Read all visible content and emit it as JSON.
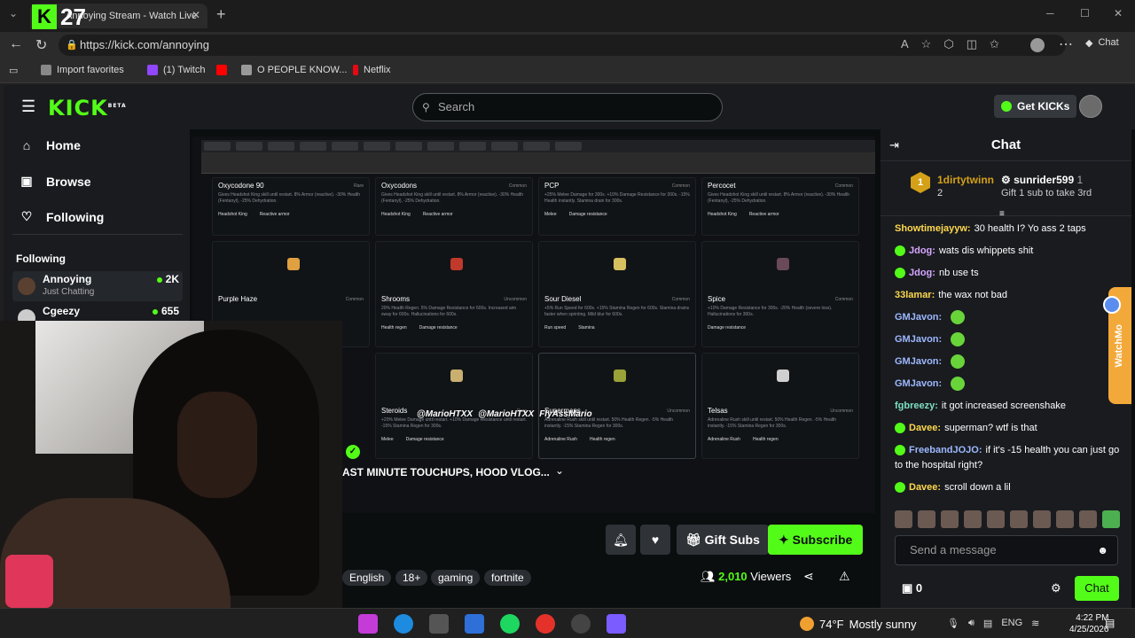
{
  "browser": {
    "tab_title": "Annoying Stream - Watch Live",
    "overlay_k": "K",
    "overlay_number": "27",
    "url": "https://kick.com/annoying",
    "chat_label": "Chat",
    "bookmarks": [
      {
        "label": "Import favorites",
        "color": "#888888"
      },
      {
        "label": "(1) Twitch",
        "color": "#9146ff"
      },
      {
        "label": "",
        "color": "#ff0000"
      },
      {
        "label": "O PEOPLE KNOW...",
        "color": "#999999"
      },
      {
        "label": "Netflix",
        "color": "#e50914"
      }
    ]
  },
  "site": {
    "logo": "KICK",
    "logo_beta": "BETA",
    "search_placeholder": "Search",
    "get_kicks": "Get KICKs",
    "sidebar": {
      "nav": [
        {
          "label": "Home",
          "icon": "home-icon"
        },
        {
          "label": "Browse",
          "icon": "browse-icon"
        },
        {
          "label": "Following",
          "icon": "heart-icon"
        }
      ],
      "following_header": "Following",
      "channels": [
        {
          "name": "Annoying",
          "category": "Just Chatting",
          "viewers": "2K"
        },
        {
          "name": "Cgeezy",
          "category": "",
          "viewers": "655"
        }
      ]
    }
  },
  "stream": {
    "title": "AST MINUTE TOUCHUPS, HOOD VLOG...",
    "tags": [
      "English",
      "18+",
      "gaming",
      "fortnite"
    ],
    "viewers_count": "2,010",
    "viewers_label": "Viewers",
    "gift_subs": "Gift Subs",
    "subscribe": "Subscribe",
    "socials": [
      "@MarioHTXX",
      "@MarioHTXX",
      "FlyAssMario"
    ],
    "cards": [
      {
        "title": "Oxycodone 90",
        "rarity": "Rare",
        "desc": "Gives Headshot King skill until restart. 8% Armor (reactive). -30% Health (Fentanyl), -25% Dehydration.",
        "tags": [
          "Headshot King",
          "Reactive armor"
        ]
      },
      {
        "title": "Oxycodons",
        "rarity": "Common",
        "desc": "Gives Headshot King skill until restart. 8% Armor (reactive). -30% Health (Fentanyl), -25% Dehydration.",
        "tags": [
          "Headshot King",
          "Reactive armor"
        ]
      },
      {
        "title": "PCP",
        "rarity": "Common",
        "desc": "+25% Melee Damage for 300s. +10% Damage Resistance for 300s. -15% Health instantly. Stamina drain for 300s.",
        "tags": [
          "Melee",
          "Damage resistance"
        ]
      },
      {
        "title": "Percocet",
        "rarity": "Common",
        "desc": "Gives Headshot King skill until restart. 8% Armor (reactive). -30% Health (Fentanyl), -25% Dehydration.",
        "tags": [
          "Headshot King",
          "Reactive armor"
        ]
      },
      {
        "title": "Purple Haze",
        "rarity": "Common",
        "desc": "",
        "tags": []
      },
      {
        "title": "Shrooms",
        "rarity": "Uncommon",
        "desc": "20% Health Regen. 5% Damage Resistance for 600s. Increased aim sway for 600s. Hallucinations for 600s.",
        "tags": [
          "Health regen",
          "Damage resistance"
        ]
      },
      {
        "title": "Sour Diesel",
        "rarity": "Common",
        "desc": "+5% Run Speed for 600s. +15% Stamina Regen for 600s. Stamina drains faster when sprinting. Mild blur for 600s.",
        "tags": [
          "Run speed",
          "Stamina"
        ]
      },
      {
        "title": "Spice",
        "rarity": "Common",
        "desc": "+10% Damage Resistance for 300s. -20% Health (severe loss). Hallucinations for 300s.",
        "tags": [
          "Damage resistance"
        ]
      },
      {
        "title": "Steroids",
        "rarity": "Rare",
        "desc": "+20% Melee Damage until restart. +10% Damage Resistance until restart. -15% Stamina Regen for 300s.",
        "tags": [
          "Melee",
          "Damage resistance"
        ]
      },
      {
        "title": "Supermans",
        "rarity": "Uncommon",
        "desc": "Adrenaline Rush skill until restart. 50% Health Regen. -5% Health instantly. -15% Stamina Regen for 300s.",
        "tags": [
          "Adrenaline Rush",
          "Health regen"
        ]
      },
      {
        "title": "Telsas",
        "rarity": "Uncommon",
        "desc": "Adrenaline Rush skill until restart. 50% Health Regen. -5% Health instantly. -15% Stamina Regen for 300s.",
        "tags": [
          "Adrenaline Rush",
          "Health regen"
        ]
      }
    ]
  },
  "chat": {
    "title": "Chat",
    "top_gifters": [
      {
        "rank": "1",
        "name": "1dirtytwinn",
        "count": "2"
      },
      {
        "name": "sunrider599",
        "count": "1",
        "caption": "Gift 1 sub to take 3rd"
      }
    ],
    "messages": [
      {
        "user": "Showtimejayyw:",
        "color": "#ffd84d",
        "badge": false,
        "text": "30 health I? Yo ass 2 taps",
        "emote": false
      },
      {
        "user": "Jdog:",
        "color": "#d6a6ff",
        "badge": true,
        "text": "wats dis whippets shit",
        "emote": false
      },
      {
        "user": "Jdog:",
        "color": "#d6a6ff",
        "badge": true,
        "text": "nb use ts",
        "emote": false
      },
      {
        "user": "33lamar:",
        "color": "#ffd84d",
        "badge": false,
        "text": "the wax not bad",
        "emote": false
      },
      {
        "user": "GMJavon:",
        "color": "#9db8ff",
        "badge": false,
        "text": "",
        "emote": true
      },
      {
        "user": "GMJavon:",
        "color": "#9db8ff",
        "badge": false,
        "text": "",
        "emote": true
      },
      {
        "user": "GMJavon:",
        "color": "#9db8ff",
        "badge": false,
        "text": "",
        "emote": true
      },
      {
        "user": "GMJavon:",
        "color": "#9db8ff",
        "badge": false,
        "text": "",
        "emote": true
      },
      {
        "user": "fgbreezy:",
        "color": "#7ee0c3",
        "badge": false,
        "text": "it got increased screenshake",
        "emote": false
      },
      {
        "user": "Davee:",
        "color": "#ffd84d",
        "badge": true,
        "text": "superman? wtf is that",
        "emote": false
      },
      {
        "user": "FreebandJOJO:",
        "color": "#9db8ff",
        "badge": true,
        "text": "if it's -15 health you can just go to the hospital right?",
        "emote": false
      },
      {
        "user": "Davee:",
        "color": "#ffd84d",
        "badge": true,
        "text": "scroll down a lil",
        "emote": false
      }
    ],
    "send_placeholder": "Send a message",
    "points": "0",
    "send_label": "Chat"
  },
  "overlay": {
    "watchmo_text": "WatchMo"
  },
  "taskbar": {
    "temperature": "74°F",
    "weather": "Mostly sunny",
    "lang": "ENG",
    "time": "4:22 PM",
    "date": "4/25/2026"
  }
}
